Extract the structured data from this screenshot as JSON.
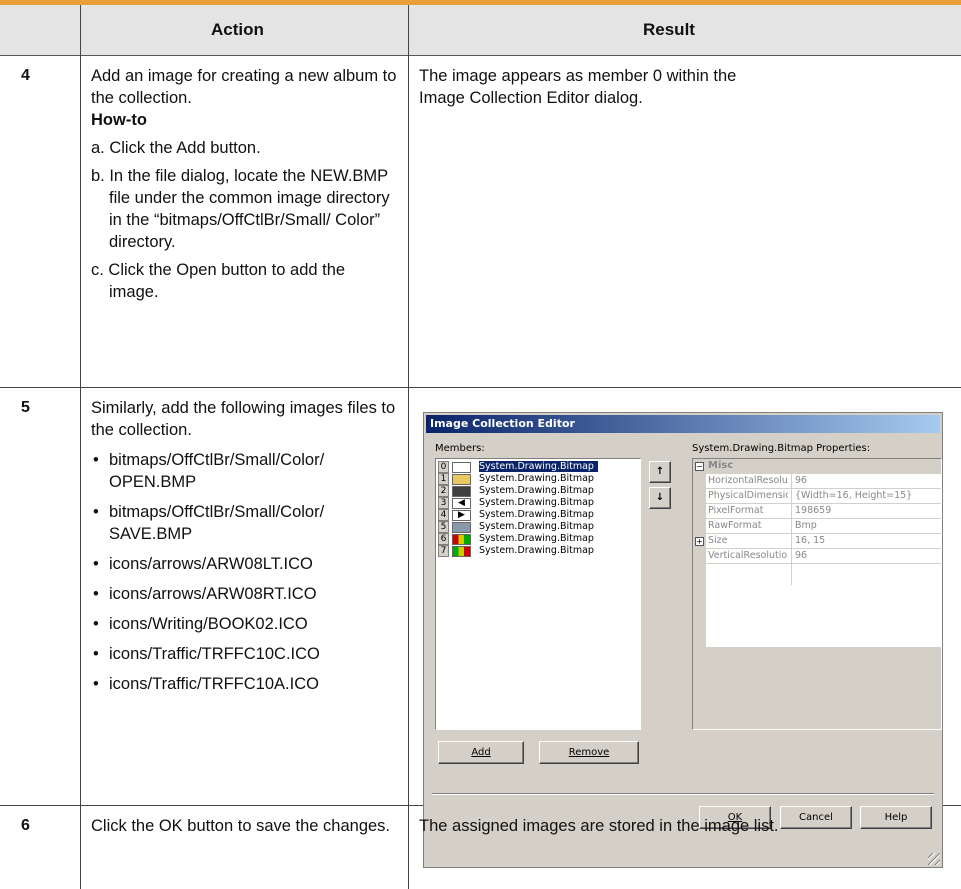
{
  "header": {
    "action": "Action",
    "result": "Result"
  },
  "rows": [
    {
      "num": "4",
      "action_text": "Add an image for creating a new album to the collection.",
      "howto_label": "How-to",
      "steps": [
        "a. Click the Add button.",
        "b. In the file dialog, locate the NEW.BMP file under the common image directory in the “bitmaps/OffCtlBr/Small/ Color” directory.",
        "c. Click the Open button to add the image."
      ],
      "result_text": "The image appears as member 0 within the Image Collection Editor dialog."
    },
    {
      "num": "5",
      "action_text": "Similarly, add the following images files to the collection.",
      "bullets": [
        "bitmaps/OffCtlBr/Small/Color/ OPEN.BMP",
        "bitmaps/OffCtlBr/Small/Color/ SAVE.BMP",
        "icons/arrows/ARW08LT.ICO",
        "icons/arrows/ARW08RT.ICO",
        "icons/Writing/BOOK02.ICO",
        "icons/Traffic/TRFFC10C.ICO",
        "icons/Traffic/TRFFC10A.ICO"
      ]
    },
    {
      "num": "6",
      "action_text": "Click the OK button to save the changes.",
      "result_text": "The assigned images are stored in the image list."
    }
  ],
  "dialog": {
    "title": "Image Collection Editor",
    "members_label": "Members:",
    "members": [
      {
        "index": "0",
        "name": "System.Drawing.Bitmap"
      },
      {
        "index": "1",
        "name": "System.Drawing.Bitmap"
      },
      {
        "index": "2",
        "name": "System.Drawing.Bitmap"
      },
      {
        "index": "3",
        "name": "System.Drawing.Bitmap"
      },
      {
        "index": "4",
        "name": "System.Drawing.Bitmap"
      },
      {
        "index": "5",
        "name": "System.Drawing.Bitmap"
      },
      {
        "index": "6",
        "name": "System.Drawing.Bitmap"
      },
      {
        "index": "7",
        "name": "System.Drawing.Bitmap"
      }
    ],
    "selected_member": "0",
    "properties_label": "System.Drawing.Bitmap Properties:",
    "category": "Misc",
    "properties": [
      {
        "name": "HorizontalResoluti",
        "value": "96"
      },
      {
        "name": "PhysicalDimensior",
        "value": "{Width=16, Height=15}"
      },
      {
        "name": "PixelFormat",
        "value": "198659"
      },
      {
        "name": "RawFormat",
        "value": "Bmp"
      },
      {
        "name": "Size",
        "value": "16, 15"
      },
      {
        "name": "VerticalResolution",
        "value": "96"
      }
    ],
    "add_label": "Add",
    "remove_label": "Remove",
    "ok_label": "OK",
    "cancel_label": "Cancel",
    "help_label": "Help",
    "up_arrow": "↑",
    "down_arrow": "↓"
  },
  "colors": {
    "accent_bar": "#e8a13a",
    "header_bg": "#e4e4e4",
    "dialog_title": "#0a246a"
  }
}
